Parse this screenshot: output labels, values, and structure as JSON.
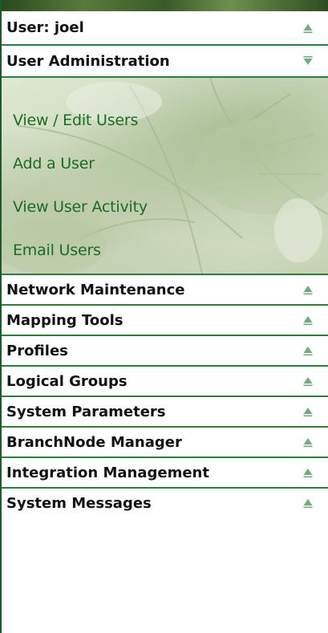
{
  "sections": {
    "user": {
      "label": "User: joel",
      "state": "collapsed"
    },
    "user_admin": {
      "label": "User Administration",
      "state": "expanded",
      "links": [
        "View / Edit Users",
        "Add a User",
        "View User Activity",
        "Email Users"
      ]
    },
    "collapsed_list": [
      "Network Maintenance",
      "Mapping Tools",
      "Profiles",
      "Logical Groups",
      "System Parameters",
      "BranchNode Manager",
      "Integration Management",
      "System Messages"
    ]
  },
  "colors": {
    "accent": "#2e7b3f",
    "link": "#1a6b25",
    "arrow": "#6fae7a"
  },
  "icons": {
    "collapsed": "triangle-up-icon",
    "expanded": "triangle-down-icon"
  }
}
